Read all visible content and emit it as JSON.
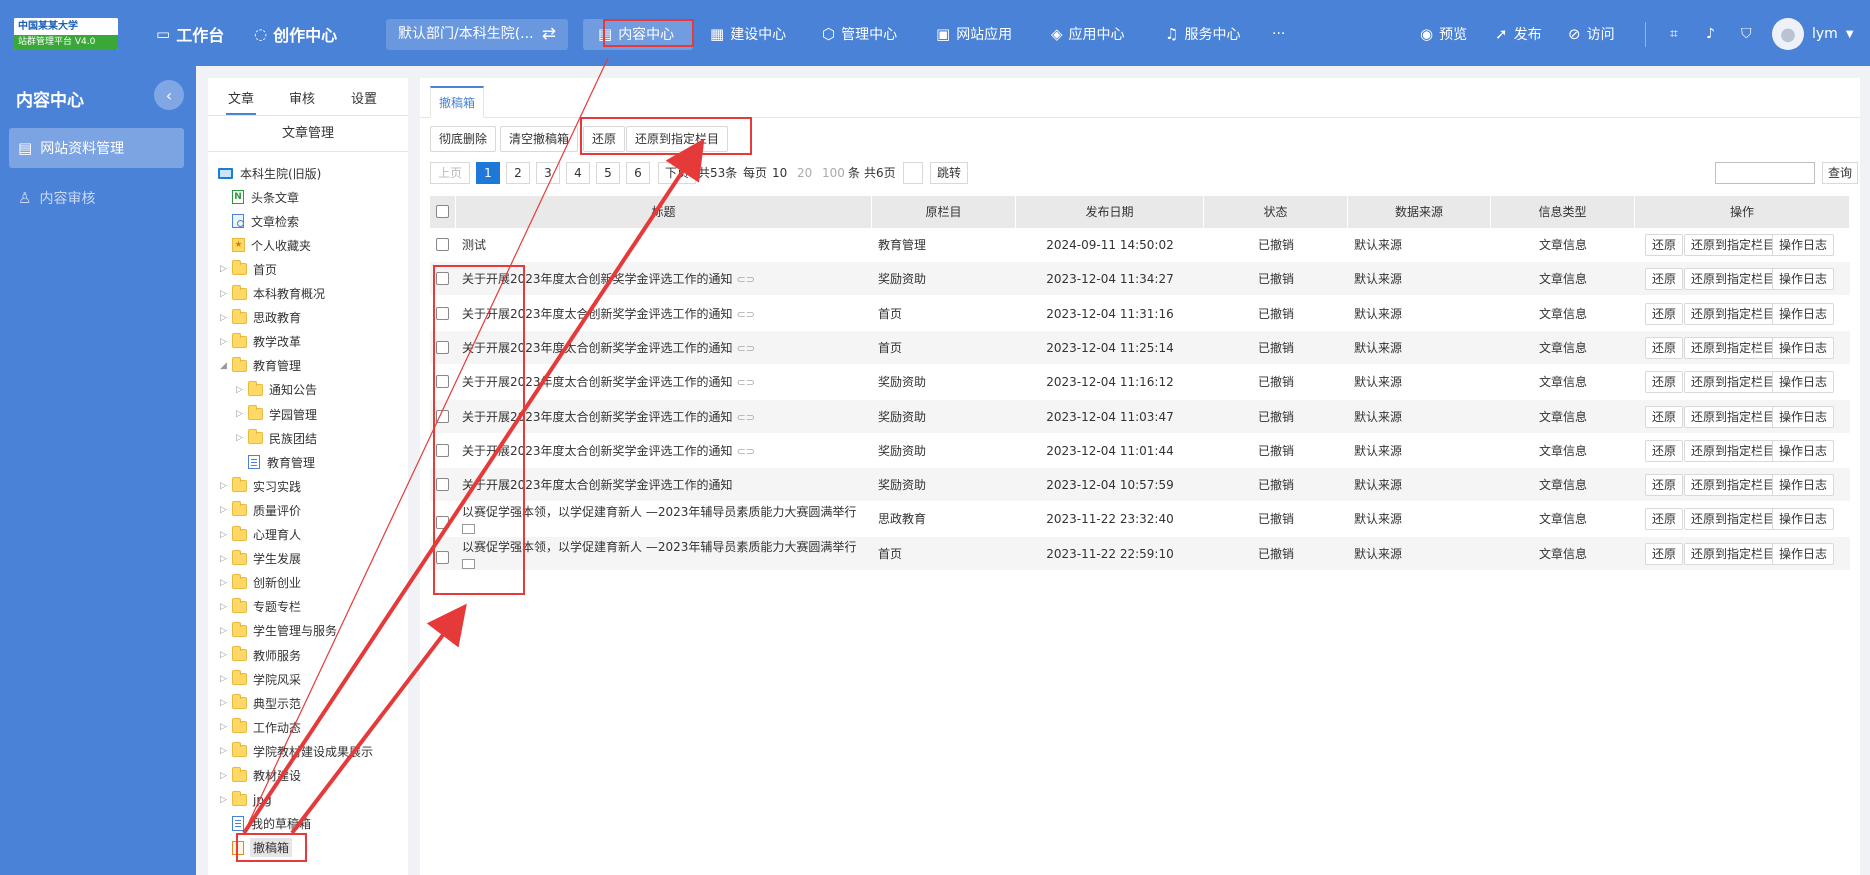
{
  "topbar": {
    "logo_line1": "中国某某大学",
    "logo_line2": "站群管理平台 V4.0",
    "workbench": "工作台",
    "creation": "创作中心",
    "dept": "默认部门/本科生院(...",
    "nav": [
      "内容中心",
      "建设中心",
      "管理中心",
      "网站应用",
      "应用中心",
      "服务中心"
    ],
    "more": "···",
    "preview": "预览",
    "publish": "发布",
    "visit": "访问",
    "user": "lym"
  },
  "sidebar": {
    "title": "内容中心",
    "items": [
      {
        "label": "网站资料管理",
        "active": true
      },
      {
        "label": "内容审核",
        "active": false
      }
    ]
  },
  "tree": {
    "tabs": [
      "文章",
      "审核",
      "设置"
    ],
    "header": "文章管理",
    "nodes": [
      {
        "label": "本科生院(旧版)",
        "type": "monitor",
        "level": 0,
        "arrow": ""
      },
      {
        "label": "头条文章",
        "type": "n",
        "level": 1,
        "arrow": ""
      },
      {
        "label": "文章检索",
        "type": "s",
        "level": 1,
        "arrow": ""
      },
      {
        "label": "个人收藏夹",
        "type": "f",
        "level": 1,
        "arrow": ""
      },
      {
        "label": "首页",
        "type": "folder",
        "level": 1,
        "arrow": "▷"
      },
      {
        "label": "本科教育概况",
        "type": "folder",
        "level": 1,
        "arrow": "▷"
      },
      {
        "label": "思政教育",
        "type": "folder",
        "level": 1,
        "arrow": "▷"
      },
      {
        "label": "教学改革",
        "type": "folder",
        "level": 1,
        "arrow": "▷"
      },
      {
        "label": "教育管理",
        "type": "folder",
        "level": 1,
        "arrow": "◢"
      },
      {
        "label": "通知公告",
        "type": "folder",
        "level": 2,
        "arrow": "▷"
      },
      {
        "label": "学园管理",
        "type": "folder",
        "level": 2,
        "arrow": "▷"
      },
      {
        "label": "民族团结",
        "type": "folder",
        "level": 2,
        "arrow": "▷"
      },
      {
        "label": "教育管理",
        "type": "doc",
        "level": 2,
        "arrow": ""
      },
      {
        "label": "实习实践",
        "type": "folder",
        "level": 1,
        "arrow": "▷"
      },
      {
        "label": "质量评价",
        "type": "folder",
        "level": 1,
        "arrow": "▷"
      },
      {
        "label": "心理育人",
        "type": "folder",
        "level": 1,
        "arrow": "▷"
      },
      {
        "label": "学生发展",
        "type": "folder",
        "level": 1,
        "arrow": "▷"
      },
      {
        "label": "创新创业",
        "type": "folder",
        "level": 1,
        "arrow": "▷"
      },
      {
        "label": "专题专栏",
        "type": "folder",
        "level": 1,
        "arrow": "▷"
      },
      {
        "label": "学生管理与服务",
        "type": "folder",
        "level": 1,
        "arrow": "▷"
      },
      {
        "label": "教师服务",
        "type": "folder",
        "level": 1,
        "arrow": "▷"
      },
      {
        "label": "学院风采",
        "type": "folder",
        "level": 1,
        "arrow": "▷"
      },
      {
        "label": "典型示范",
        "type": "folder",
        "level": 1,
        "arrow": "▷"
      },
      {
        "label": "工作动态",
        "type": "folder",
        "level": 1,
        "arrow": "▷"
      },
      {
        "label": "学院教材建设成果展示",
        "type": "folder",
        "level": 1,
        "arrow": "▷"
      },
      {
        "label": "教材建设",
        "type": "folder",
        "level": 1,
        "arrow": "▷"
      },
      {
        "label": "jpg",
        "type": "folder",
        "level": 1,
        "arrow": "▷"
      },
      {
        "label": "我的草稿箱",
        "type": "draft",
        "level": 1,
        "arrow": ""
      },
      {
        "label": "撤稿箱",
        "type": "recycle",
        "level": 1,
        "arrow": "",
        "selected": true
      }
    ]
  },
  "main": {
    "tab": "撤稿箱",
    "toolbar": [
      "彻底删除",
      "清空撤稿箱",
      "还原",
      "还原到指定栏目"
    ],
    "pager": {
      "prev": "上页",
      "pages": [
        "1",
        "2",
        "3",
        "4",
        "5",
        "6"
      ],
      "next": "下页",
      "total": "共53条",
      "per_page_label": "每页",
      "sizes": [
        "10",
        "20",
        "100"
      ],
      "unit": "条",
      "pages_total": "共6页",
      "jump": "跳转"
    },
    "search_button": "查询",
    "columns": [
      "标题",
      "原栏目",
      "发布日期",
      "状态",
      "数据来源",
      "信息类型",
      "操作"
    ],
    "rows": [
      {
        "title": "测试",
        "column": "教育管理",
        "date": "2024-09-11 14:50:02",
        "status": "已撤销",
        "source": "默认来源",
        "type": "文章信息",
        "link": false,
        "img": false
      },
      {
        "title": "关于开展2023年度太合创新奖学金评选工作的通知",
        "column": "奖励资助",
        "date": "2023-12-04 11:34:27",
        "status": "已撤销",
        "source": "默认来源",
        "type": "文章信息",
        "link": true,
        "img": false
      },
      {
        "title": "关于开展2023年度太合创新奖学金评选工作的通知",
        "column": "首页",
        "date": "2023-12-04 11:31:16",
        "status": "已撤销",
        "source": "默认来源",
        "type": "文章信息",
        "link": true,
        "img": false
      },
      {
        "title": "关于开展2023年度太合创新奖学金评选工作的通知",
        "column": "首页",
        "date": "2023-12-04 11:25:14",
        "status": "已撤销",
        "source": "默认来源",
        "type": "文章信息",
        "link": true,
        "img": false
      },
      {
        "title": "关于开展2023年度太合创新奖学金评选工作的通知",
        "column": "奖励资助",
        "date": "2023-12-04 11:16:12",
        "status": "已撤销",
        "source": "默认来源",
        "type": "文章信息",
        "link": true,
        "img": false
      },
      {
        "title": "关于开展2023年度太合创新奖学金评选工作的通知",
        "column": "奖励资助",
        "date": "2023-12-04 11:03:47",
        "status": "已撤销",
        "source": "默认来源",
        "type": "文章信息",
        "link": true,
        "img": false
      },
      {
        "title": "关于开展2023年度太合创新奖学金评选工作的通知",
        "column": "奖励资助",
        "date": "2023-12-04 11:01:44",
        "status": "已撤销",
        "source": "默认来源",
        "type": "文章信息",
        "link": true,
        "img": false
      },
      {
        "title": "关于开展2023年度太合创新奖学金评选工作的通知",
        "column": "奖励资助",
        "date": "2023-12-04 10:57:59",
        "status": "已撤销",
        "source": "默认来源",
        "type": "文章信息",
        "link": false,
        "img": false
      },
      {
        "title": "以赛促学强本领，以学促建育新人 —2023年辅导员素质能力大赛圆满举行",
        "column": "思政教育",
        "date": "2023-11-22 23:32:40",
        "status": "已撤销",
        "source": "默认来源",
        "type": "文章信息",
        "link": false,
        "img": true
      },
      {
        "title": "以赛促学强本领，以学促建育新人 —2023年辅导员素质能力大赛圆满举行",
        "column": "首页",
        "date": "2023-11-22 22:59:10",
        "status": "已撤销",
        "source": "默认来源",
        "type": "文章信息",
        "link": false,
        "img": true
      }
    ],
    "row_actions": [
      "还原",
      "还原到指定栏目",
      "操作日志"
    ]
  },
  "colors": {
    "topbar": "#4a82d8",
    "accent": "#1e78d7",
    "annotation": "#e63a3a"
  }
}
